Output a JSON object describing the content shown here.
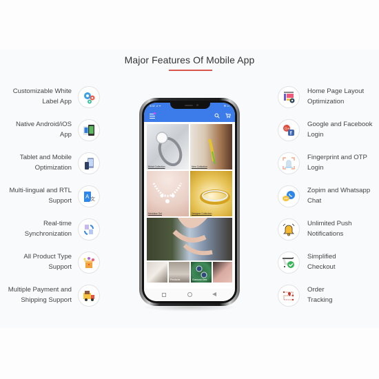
{
  "section": {
    "title": "Major Features Of Mobile App",
    "accent_color": "#d9534f"
  },
  "features_left": [
    {
      "line1": "Customizable White",
      "line2": "Label App",
      "icon": "gears-icon"
    },
    {
      "line1": "Native Android/iOS",
      "line2": "App",
      "icon": "native-apps-icon"
    },
    {
      "line1": "Tablet and Mobile",
      "line2": "Optimization",
      "icon": "tablet-mobile-icon"
    },
    {
      "line1": "Multi-lingual and RTL",
      "line2": "Support",
      "icon": "translate-icon"
    },
    {
      "line1": "Real-time",
      "line2": "Synchronization",
      "icon": "sync-icon"
    },
    {
      "line1": "All Product Type",
      "line2": "Support",
      "icon": "product-box-icon"
    },
    {
      "line1": "Multiple Payment and",
      "line2": "Shipping Support",
      "icon": "delivery-truck-icon"
    }
  ],
  "features_right": [
    {
      "line1": "Home Page Layout",
      "line2": "Optimization",
      "icon": "layout-settings-icon"
    },
    {
      "line1": "Google and Facebook",
      "line2": "Login",
      "icon": "social-login-icon"
    },
    {
      "line1": "Fingerprint and OTP",
      "line2": "Login",
      "icon": "fingerprint-icon"
    },
    {
      "line1": "Zopim and Whatsapp",
      "line2": "Chat",
      "icon": "chat-icon"
    },
    {
      "line1": "Unlimited Push",
      "line2": "Notifications",
      "icon": "bell-icon"
    },
    {
      "line1": "Simplified",
      "line2": "Checkout",
      "icon": "checkout-cart-icon"
    },
    {
      "line1": "Order",
      "line2": "Tracking",
      "icon": "order-tracking-icon"
    }
  ],
  "phone": {
    "status_time": "3:02 .ıl ᯤ",
    "status_right": "⚙ ▭",
    "brand_color": "#3c7bea",
    "tiles": [
      {
        "caption": "Bridal Collection"
      },
      {
        "caption": "New Collection"
      },
      {
        "caption": "Necklace Set"
      },
      {
        "caption": "Designer Collection"
      },
      {
        "caption": ""
      },
      {
        "caption": ""
      },
      {
        "caption": "Pendants"
      },
      {
        "caption": "Diamond Sets"
      },
      {
        "caption": ""
      }
    ]
  }
}
